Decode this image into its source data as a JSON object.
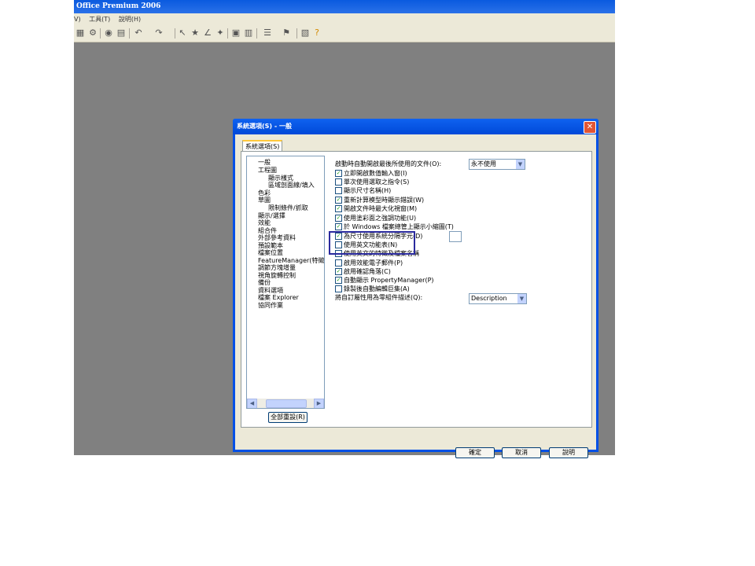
{
  "app": {
    "title": "Office Premium 2006",
    "menu": [
      "V)",
      "工具(T)",
      "說明(H)"
    ]
  },
  "dialog": {
    "title": "系統選項(S) - 一般",
    "close_symbol": "✕",
    "tab_label": "系統選項(S)",
    "tree_items": [
      "一般",
      "工程圖",
      "顯示樣式",
      "區域剖面線/填入",
      "色彩",
      "草圖",
      "限制條件/抓取",
      "顯示/選擇",
      "效能",
      "組合件",
      "外部參考資料",
      "預設範本",
      "檔案位置",
      "FeatureManager(特徵管理",
      "調節方塊增量",
      "視角旋轉控制",
      "備份",
      "資料選項",
      "檔案 Explorer",
      "協同作業"
    ],
    "reset_label": "全部重設(R)",
    "open_last_doc_label": "啟動時自動開啟最後所使用的文件(O):",
    "open_last_doc_value": "永不使用",
    "options": [
      {
        "label": "立即開啟數值輸入窗(I)",
        "checked": true
      },
      {
        "label": "單次使用選取之指令(S)",
        "checked": false
      },
      {
        "label": "顯示尺寸名稱(H)",
        "checked": false
      },
      {
        "label": "重新計算模型時顯示錯誤(W)",
        "checked": true
      },
      {
        "label": "開啟文件時最大化視窗(M)",
        "checked": true
      },
      {
        "label": "使用塗彩面之強調功能(U)",
        "checked": true
      },
      {
        "label": "於 Windows 檔案總管上顯示小縮圖(T)",
        "checked": true
      },
      {
        "label": "為尺寸使用系統分隔字元(D)",
        "checked": true
      },
      {
        "label": "使用英文功能表(N)",
        "checked": false
      },
      {
        "label": "使用英文的特徵及檔案名稱",
        "checked": false
      },
      {
        "label": "啟用效能電子郵件(P)",
        "checked": false
      },
      {
        "label": "啟用確認角落(C)",
        "checked": true
      },
      {
        "label": "自動顯示 PropertyManager(P)",
        "checked": true
      },
      {
        "label": "錄製後自動編輯巨集(A)",
        "checked": false
      }
    ],
    "description_label": "將自訂屬性用為零組件描述(Q):",
    "description_value": "Description",
    "ok_label": "確定",
    "cancel_label": "取消",
    "help_label": "說明"
  },
  "colors": {
    "titlebar": "#0a5adf",
    "highlight_box": "#2a2a9e",
    "dialog_face": "#ece9d8"
  }
}
